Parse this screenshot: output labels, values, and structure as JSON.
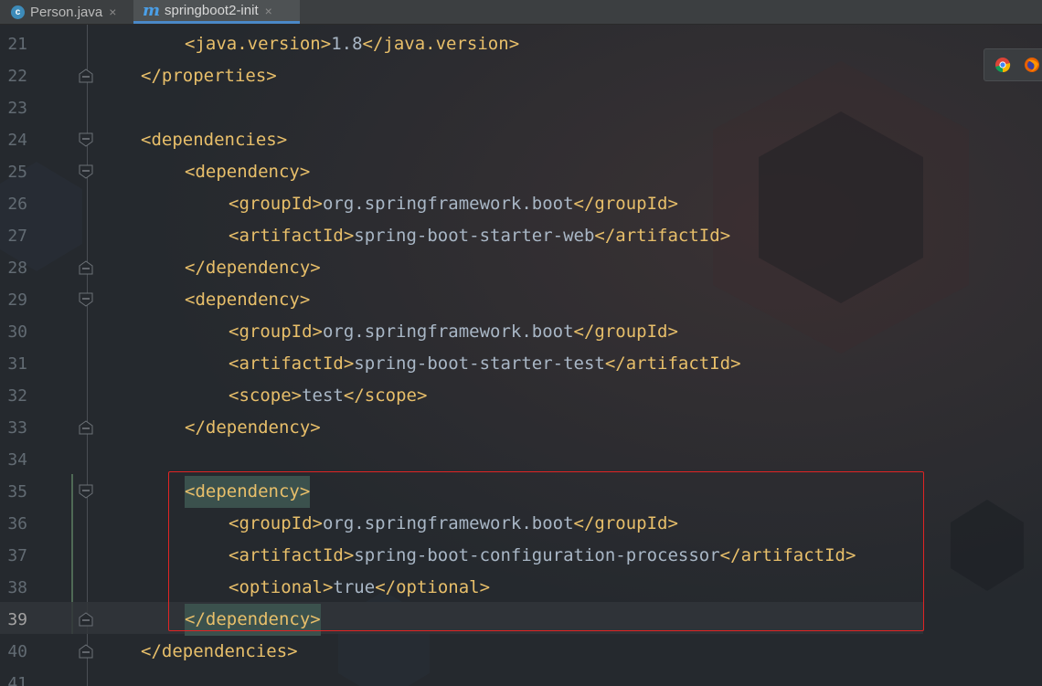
{
  "tabs": [
    {
      "label": "Person.java",
      "icon": "class-icon",
      "icon_letter": "c",
      "active": false
    },
    {
      "label": "springboot2-init",
      "icon": "maven-icon",
      "icon_letter": "m",
      "active": true
    }
  ],
  "close_glyph": "×",
  "lines": [
    {
      "num": "21",
      "indent": 2,
      "segments": [
        [
          "b",
          "<"
        ],
        [
          "t",
          "java.version"
        ],
        [
          "b",
          ">"
        ],
        [
          "v",
          "1.8"
        ],
        [
          "b",
          "</"
        ],
        [
          "t",
          "java.version"
        ],
        [
          "b",
          ">"
        ]
      ]
    },
    {
      "num": "22",
      "indent": 1,
      "fold": "end",
      "segments": [
        [
          "b",
          "</"
        ],
        [
          "t",
          "properties"
        ],
        [
          "b",
          ">"
        ]
      ]
    },
    {
      "num": "23",
      "indent": 0,
      "segments": []
    },
    {
      "num": "24",
      "indent": 1,
      "fold": "start",
      "segments": [
        [
          "b",
          "<"
        ],
        [
          "t",
          "dependencies"
        ],
        [
          "b",
          ">"
        ]
      ]
    },
    {
      "num": "25",
      "indent": 2,
      "fold": "start",
      "segments": [
        [
          "b",
          "<"
        ],
        [
          "t",
          "dependency"
        ],
        [
          "b",
          ">"
        ]
      ]
    },
    {
      "num": "26",
      "indent": 3,
      "segments": [
        [
          "b",
          "<"
        ],
        [
          "t",
          "groupId"
        ],
        [
          "b",
          ">"
        ],
        [
          "v",
          "org.springframework.boot"
        ],
        [
          "b",
          "</"
        ],
        [
          "t",
          "groupId"
        ],
        [
          "b",
          ">"
        ]
      ]
    },
    {
      "num": "27",
      "indent": 3,
      "segments": [
        [
          "b",
          "<"
        ],
        [
          "t",
          "artifactId"
        ],
        [
          "b",
          ">"
        ],
        [
          "v",
          "spring-boot-starter-web"
        ],
        [
          "b",
          "</"
        ],
        [
          "t",
          "artifactId"
        ],
        [
          "b",
          ">"
        ]
      ]
    },
    {
      "num": "28",
      "indent": 2,
      "fold": "end",
      "segments": [
        [
          "b",
          "</"
        ],
        [
          "t",
          "dependency"
        ],
        [
          "b",
          ">"
        ]
      ]
    },
    {
      "num": "29",
      "indent": 2,
      "fold": "start",
      "segments": [
        [
          "b",
          "<"
        ],
        [
          "t",
          "dependency"
        ],
        [
          "b",
          ">"
        ]
      ]
    },
    {
      "num": "30",
      "indent": 3,
      "segments": [
        [
          "b",
          "<"
        ],
        [
          "t",
          "groupId"
        ],
        [
          "b",
          ">"
        ],
        [
          "v",
          "org.springframework.boot"
        ],
        [
          "b",
          "</"
        ],
        [
          "t",
          "groupId"
        ],
        [
          "b",
          ">"
        ]
      ]
    },
    {
      "num": "31",
      "indent": 3,
      "segments": [
        [
          "b",
          "<"
        ],
        [
          "t",
          "artifactId"
        ],
        [
          "b",
          ">"
        ],
        [
          "v",
          "spring-boot-starter-test"
        ],
        [
          "b",
          "</"
        ],
        [
          "t",
          "artifactId"
        ],
        [
          "b",
          ">"
        ]
      ]
    },
    {
      "num": "32",
      "indent": 3,
      "segments": [
        [
          "b",
          "<"
        ],
        [
          "t",
          "scope"
        ],
        [
          "b",
          ">"
        ],
        [
          "v",
          "test"
        ],
        [
          "b",
          "</"
        ],
        [
          "t",
          "scope"
        ],
        [
          "b",
          ">"
        ]
      ]
    },
    {
      "num": "33",
      "indent": 2,
      "fold": "end",
      "segments": [
        [
          "b",
          "</"
        ],
        [
          "t",
          "dependency"
        ],
        [
          "b",
          ">"
        ]
      ]
    },
    {
      "num": "34",
      "indent": 0,
      "segments": []
    },
    {
      "num": "35",
      "indent": 2,
      "fold": "start",
      "highlight": true,
      "segments": [
        [
          "b",
          "<"
        ],
        [
          "t",
          "dependency"
        ],
        [
          "b",
          ">"
        ]
      ]
    },
    {
      "num": "36",
      "indent": 3,
      "segments": [
        [
          "b",
          "<"
        ],
        [
          "t",
          "groupId"
        ],
        [
          "b",
          ">"
        ],
        [
          "v",
          "org.springframework.boot"
        ],
        [
          "b",
          "</"
        ],
        [
          "t",
          "groupId"
        ],
        [
          "b",
          ">"
        ]
      ]
    },
    {
      "num": "37",
      "indent": 3,
      "segments": [
        [
          "b",
          "<"
        ],
        [
          "t",
          "artifactId"
        ],
        [
          "b",
          ">"
        ],
        [
          "v",
          "spring-boot-configuration-processor"
        ],
        [
          "b",
          "</"
        ],
        [
          "t",
          "artifactId"
        ],
        [
          "b",
          ">"
        ]
      ]
    },
    {
      "num": "38",
      "indent": 3,
      "segments": [
        [
          "b",
          "<"
        ],
        [
          "t",
          "optional"
        ],
        [
          "b",
          ">"
        ],
        [
          "v",
          "true"
        ],
        [
          "b",
          "</"
        ],
        [
          "t",
          "optional"
        ],
        [
          "b",
          ">"
        ]
      ]
    },
    {
      "num": "39",
      "indent": 2,
      "fold": "end",
      "highlight": true,
      "current": true,
      "segments": [
        [
          "b",
          "</"
        ],
        [
          "t",
          "dependency"
        ],
        [
          "b",
          ">"
        ]
      ]
    },
    {
      "num": "40",
      "indent": 1,
      "fold": "end",
      "segments": [
        [
          "b",
          "</"
        ],
        [
          "t",
          "dependencies"
        ],
        [
          "b",
          ">"
        ]
      ]
    },
    {
      "num": "41",
      "indent": 0,
      "segments": []
    }
  ],
  "browser_icons": [
    "chrome-icon",
    "firefox-icon"
  ],
  "colors": {
    "tag": "#e8bf6a",
    "text": "#a9b7c6",
    "line_number": "#626b73",
    "selection_box": "#e02424",
    "active_tab_underline": "#4a88c7"
  }
}
